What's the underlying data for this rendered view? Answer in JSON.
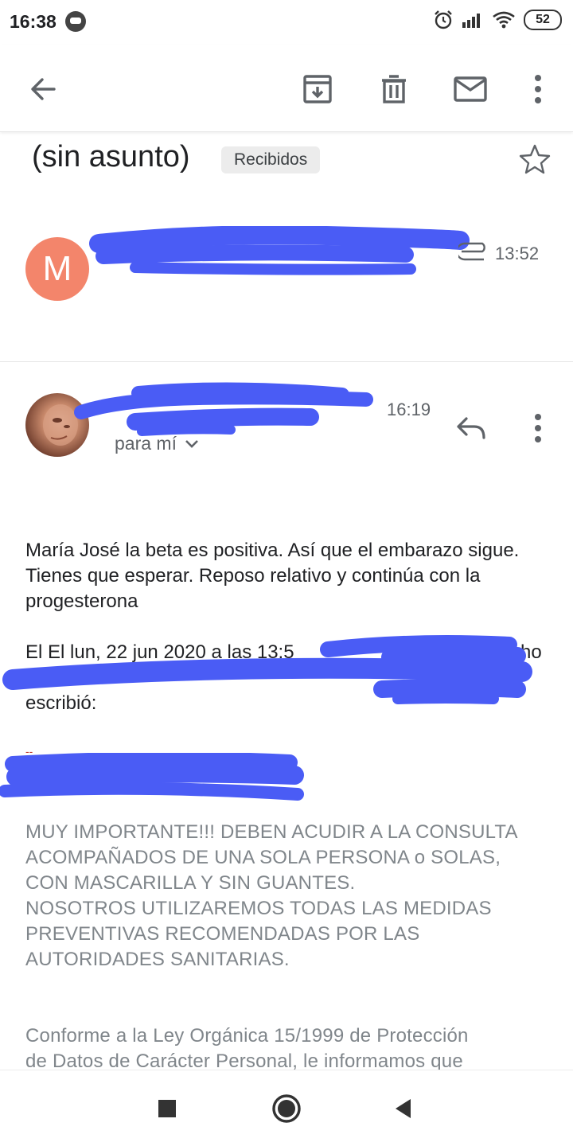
{
  "status_bar": {
    "time": "16:38",
    "battery": "52",
    "icons": [
      "alarm-icon",
      "signal-icon",
      "wifi-icon",
      "battery-icon"
    ]
  },
  "toolbar": {
    "icons": [
      "back-arrow-icon",
      "archive-icon",
      "trash-icon",
      "mail-icon",
      "more-vert-icon"
    ]
  },
  "email": {
    "subject": "(sin asunto)",
    "label": "Recibidos"
  },
  "message_1": {
    "avatar_letter": "M",
    "avatar_color": "#f3856b",
    "time": "13:52"
  },
  "message_2": {
    "time": "16:19",
    "recipient": "para mí",
    "body": {
      "paragraph_1": "María José la beta es positiva. Así que el embarazo sigue. Tienes que esperar. Reposo relativo y continúa con la progesterona",
      "quote_line_1": "El El lun, 22 jun 2020 a las 13:5",
      "quote_line_1_end": "ho",
      "quote_line_3": "escribió:",
      "sig_separator": "--",
      "notice": [
        "MUY IMPORTANTE!!! DEBEN ACUDIR A LA CONSULTA",
        "ACOMPAÑADOS DE UNA SOLA PERSONA o SOLAS,",
        "CON MASCARILLA Y SIN GUANTES.",
        "NOSOTROS UTILIZAREMOS TODAS LAS MEDIDAS",
        "PREVENTIVAS RECOMENDADAS POR LAS",
        "AUTORIDADES SANITARIAS."
      ],
      "legal": [
        "Conforme a la Ley Orgánica 15/1999 de Protección",
        "de Datos de Carácter Personal, le informamos que"
      ]
    }
  },
  "colors": {
    "redaction": "#4a5cf5",
    "accent_avatar": "#f3856b",
    "muted_text": "#80868b"
  },
  "nav_bar": {
    "icons": [
      "recents-square-icon",
      "home-circle-icon",
      "back-triangle-icon"
    ]
  }
}
